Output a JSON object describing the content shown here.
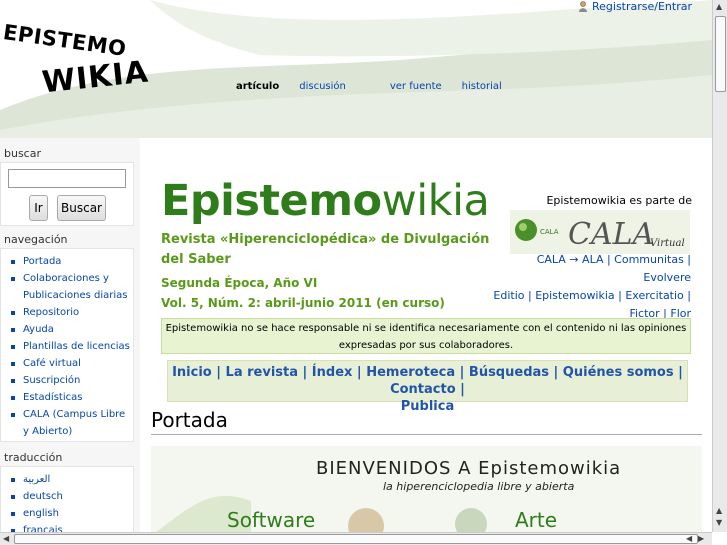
{
  "header": {
    "logo_line1": "EPISTEMO",
    "logo_line2": "WIKIA",
    "user_link": "Registrarse/Entrar",
    "tabs": [
      {
        "label": "artículo"
      },
      {
        "label": "discusión"
      },
      {
        "label": "ver fuente"
      },
      {
        "label": "historial"
      }
    ]
  },
  "sidebar": {
    "search_heading": "buscar",
    "search_placeholder": "",
    "go_button": "Ir",
    "search_button": "Buscar",
    "nav_heading": "navegación",
    "nav_items": [
      {
        "label": "Portada"
      },
      {
        "label": "Colaboraciones y Publicaciones diarias"
      },
      {
        "label": "Repositorio"
      },
      {
        "label": "Ayuda"
      },
      {
        "label": "Plantillas de licencias"
      },
      {
        "label": "Café virtual"
      },
      {
        "label": "Suscripción"
      },
      {
        "label": "Estadísticas"
      },
      {
        "label": "CALA (Campus Libre y Abierto)"
      }
    ],
    "translation_heading": "traducción",
    "translation_items": [
      {
        "label": "العربية"
      },
      {
        "label": "deutsch"
      },
      {
        "label": "english"
      },
      {
        "label": "français"
      }
    ]
  },
  "main": {
    "title_bold": "Epistemo",
    "title_thin": "wikia",
    "subtitle": "Revista «Hiperenciclopédica» de Divulgación del Saber",
    "epoca": "Segunda Época, Año VI",
    "volume": "Vol. 5, Núm. 2: abril-junio 2011 (en curso)",
    "part_of": "Epistemowikia es parte de",
    "cala_logo_text": "CALA",
    "cala_logo_sub": "Virtual",
    "cala_links_line1": "CALA → ALA | Communitas | Evolvere",
    "cala_links_line2": "Editio | Epistemowikia | Exercitatio |",
    "cala_links_line3": "Fictor | Flor",
    "disclaimer": "Epistemowikia no se hace responsable ni se identifica necesariamente con el contenido ni las opiniones expresadas por sus colaboradores.",
    "menu_line1": "Inicio | La revista | Índex | Hemeroteca | Búsquedas | Quiénes somos | Contacto |",
    "menu_line2": "Publica",
    "page_heading": "Portada",
    "banner_title": "BIENVENIDOS A Epistemowikia",
    "banner_subtitle": "la hiperenciclopedia libre y abierta",
    "banner_left": "Software",
    "banner_right": "Arte"
  },
  "colors": {
    "brand_green": "#2f7d1a",
    "link_blue": "#0645ad",
    "disclaimer_bg": "#e8f3d2"
  }
}
